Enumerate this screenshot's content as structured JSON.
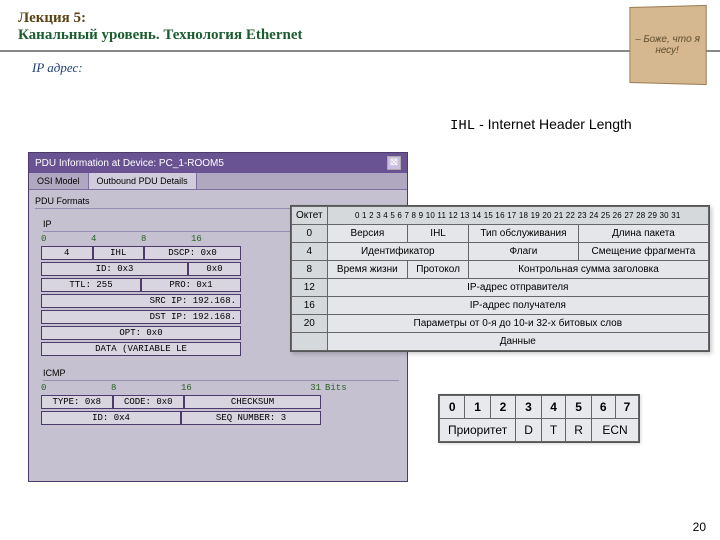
{
  "header": {
    "lecture_num": "Лекция 5:",
    "lecture_title": "Канальный уровень. Технология Ethernet",
    "ip_title": "IP адрес:"
  },
  "ihl_label": "IHL",
  "ihl_sep": "-",
  "ihl_full": "Internet Header Length",
  "bag_text": "– Боже, что я несу!",
  "page_number": "20",
  "pdu_window": {
    "title": "PDU Information at Device: PC_1-ROOM5",
    "tabs": {
      "osi": "OSI Model",
      "out": "Outbound PDU Details"
    },
    "formats_label": "PDU Formats",
    "ip": {
      "label": "IP",
      "ruler": {
        "a": "0",
        "b": "4",
        "c": "8",
        "d": "16"
      },
      "row1": {
        "ver": "4",
        "ihl": "IHL",
        "dscp": "DSCP: 0x0"
      },
      "row2": {
        "id": "ID: 0x3",
        "flags": "0x0"
      },
      "row3": {
        "ttl": "TTL: 255",
        "pro": "PRO: 0x1"
      },
      "src": "SRC IP: 192.168.",
      "dst": "DST IP: 192.168.",
      "opt": "OPT: 0x0",
      "data": "DATA (VARIABLE LE"
    },
    "icmp": {
      "label": "ICMP",
      "ruler": {
        "a": "0",
        "b": "8",
        "c": "16",
        "d": "31"
      },
      "bits": "Bits",
      "row1": {
        "type": "TYPE: 0x8",
        "code": "CODE: 0x0",
        "chk": "CHECKSUM"
      },
      "row2": {
        "id": "ID: 0x4",
        "seq": "SEQ NUMBER: 3"
      }
    }
  },
  "ip_header": {
    "octet_label": "Октет",
    "bit_header": "0  1  2  3  4  5  6  7  8  9 10 11 12 13 14 15 16 17 18 19 20 21 22 23 24 25 26 27 28 29 30 31",
    "rows": [
      {
        "octet": "0",
        "c1": "Версия",
        "c2": "IHL",
        "c3": "Тип обслуживания",
        "c4": "Длина пакета"
      },
      {
        "octet": "4",
        "c1": "Идентификатор",
        "c2": "Флаги",
        "c3": "Смещение фрагмента"
      },
      {
        "octet": "8",
        "c1": "Время жизни",
        "c2": "Протокол",
        "c3": "Контрольная сумма заголовка"
      },
      {
        "octet": "12",
        "c1": "IP-адрес отправителя"
      },
      {
        "octet": "16",
        "c1": "IP-адрес получателя"
      },
      {
        "octet": "20",
        "c1": "Параметры от 0-я до 10-и 32-х битовых слов"
      },
      {
        "octet": "",
        "c1": "Данные"
      }
    ]
  },
  "priority": {
    "bits": [
      "0",
      "1",
      "2",
      "3",
      "4",
      "5",
      "6",
      "7"
    ],
    "labels": {
      "pri": "Приоритет",
      "d": "D",
      "t": "T",
      "r": "R",
      "ecn": "ECN"
    }
  }
}
